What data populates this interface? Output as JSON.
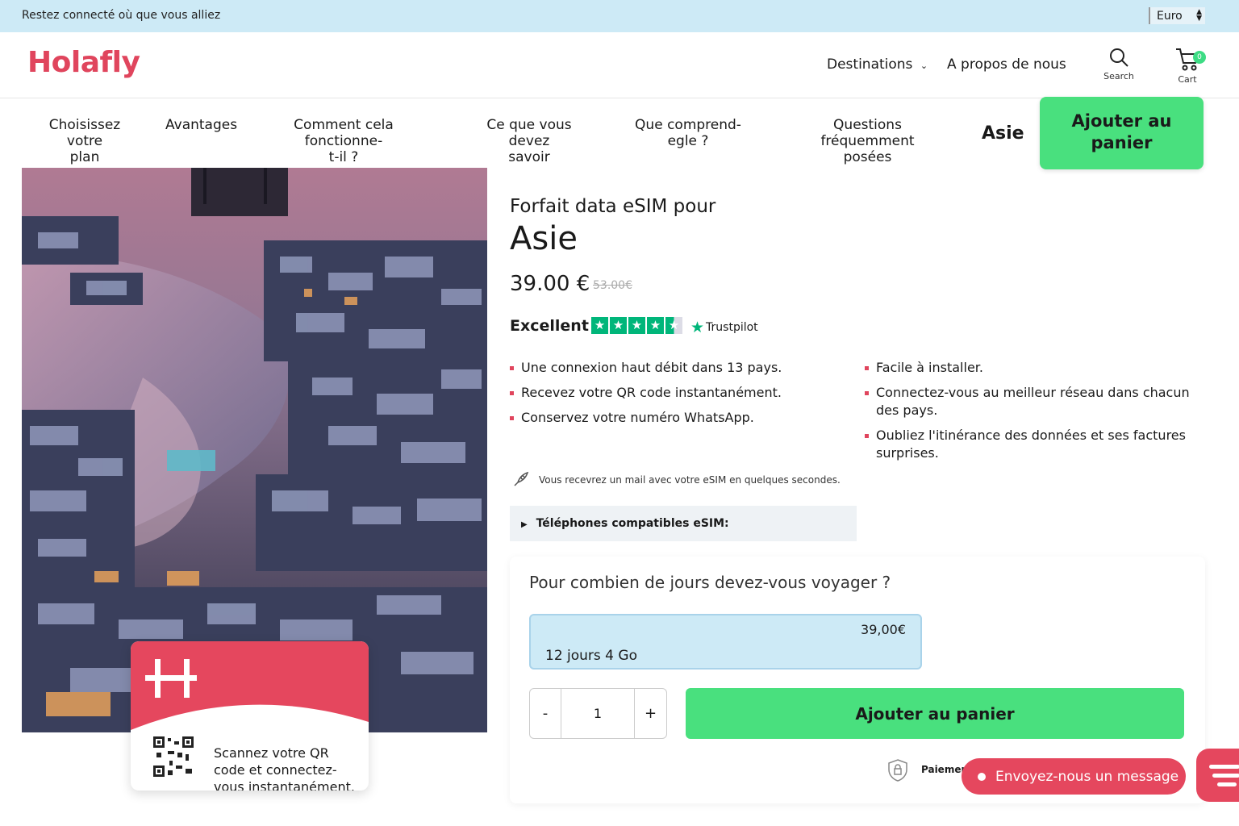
{
  "topbar": {
    "tagline": "Restez connecté où que vous alliez",
    "currency": "Euro"
  },
  "header": {
    "logo": "Holafly",
    "nav": {
      "destinations": "Destinations",
      "about": "A propos de nous"
    },
    "search_label": "Search",
    "cart_label": "Cart",
    "cart_count": "0"
  },
  "subnav": {
    "items": [
      {
        "line1": "Choisissez votre",
        "line2": "plan"
      },
      {
        "line1": "Avantages",
        "line2": ""
      },
      {
        "line1": "Comment cela fonctionne-",
        "line2": "t-il ?"
      },
      {
        "line1": "Ce que vous devez",
        "line2": "savoir"
      },
      {
        "line1": "Que comprend-",
        "line2": "egle ?"
      },
      {
        "line1": "Questions fréquemment",
        "line2": "posées"
      }
    ],
    "title": "Asie",
    "cta_line1": "Ajouter au",
    "cta_line2": "panier"
  },
  "promo_card": {
    "line1": "Scannez votre QR",
    "line2": "code et connectez-",
    "line3": "vous instantanément."
  },
  "product": {
    "pre_title": "Forfait data eSIM pour",
    "title": "Asie",
    "price": "39.00 €",
    "old_price": "53.00€",
    "rating_label": "Excellent",
    "rating_stars": 4.5,
    "trustpilot": "Trustpilot",
    "features_left": [
      "Une connexion haut débit dans 13 pays.",
      "Recevez votre QR code instantanément.",
      "Conservez votre numéro WhatsApp."
    ],
    "features_right": [
      "Facile à installer.",
      "Connectez-vous au meilleur réseau dans chacun des pays.",
      "Oubliez l'itinérance des données et ses factures surprises."
    ],
    "email_note": "Vous recevrez un mail avec votre eSIM en quelques secondes.",
    "compat_label": "Téléphones compatibles eSIM:"
  },
  "purchase": {
    "question": "Pour combien de jours devez-vous voyager ?",
    "plan_price": "39,00€",
    "plan_name": "12 jours 4 Go",
    "qty_minus": "-",
    "qty_value": "1",
    "qty_plus": "+",
    "add_to_cart": "Ajouter au panier",
    "payment_label": "Paiemen"
  },
  "chat": {
    "message_label": "Envoyez-nous un message"
  },
  "colors": {
    "brand": "#e5475e",
    "cta": "#49e07e",
    "topbar": "#cdeaf6",
    "trustpilot": "#00b67a"
  }
}
